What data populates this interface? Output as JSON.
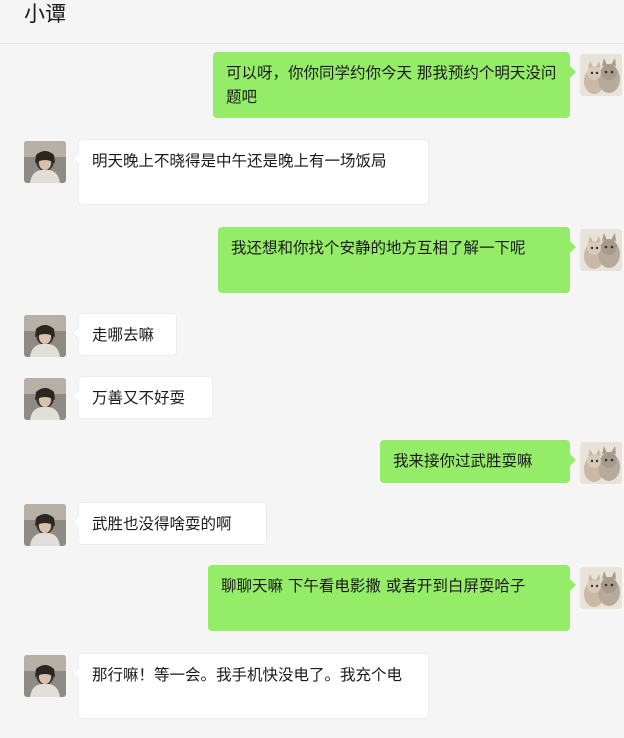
{
  "header": {
    "title": "小谭"
  },
  "messages": [
    {
      "side": "out",
      "text": "可以呀，你你同学约你今天 那我预约个明天没问题吧"
    },
    {
      "side": "in",
      "text": "明天晚上不晓得是中午还是晚上有一场饭局"
    },
    {
      "side": "out",
      "text": "我还想和你找个安静的地方互相了解一下呢"
    },
    {
      "side": "in",
      "text": "走哪去嘛"
    },
    {
      "side": "in",
      "text": "万善又不好耍"
    },
    {
      "side": "out",
      "text": "我来接你过武胜耍嘛"
    },
    {
      "side": "in",
      "text": "武胜也没得啥耍的啊"
    },
    {
      "side": "out",
      "text": "聊聊天嘛 下午看电影撒 或者开到白屏耍哈子"
    },
    {
      "side": "in",
      "text": "那行嘛！等一会。我手机快没电了。我充个电"
    }
  ],
  "colors": {
    "outgoing_bubble": "#95ec69",
    "incoming_bubble": "#ffffff",
    "background": "#f5f5f5"
  },
  "icons": {
    "self_avatar": "cat-avatar-icon",
    "contact_avatar": "person-avatar-icon"
  }
}
